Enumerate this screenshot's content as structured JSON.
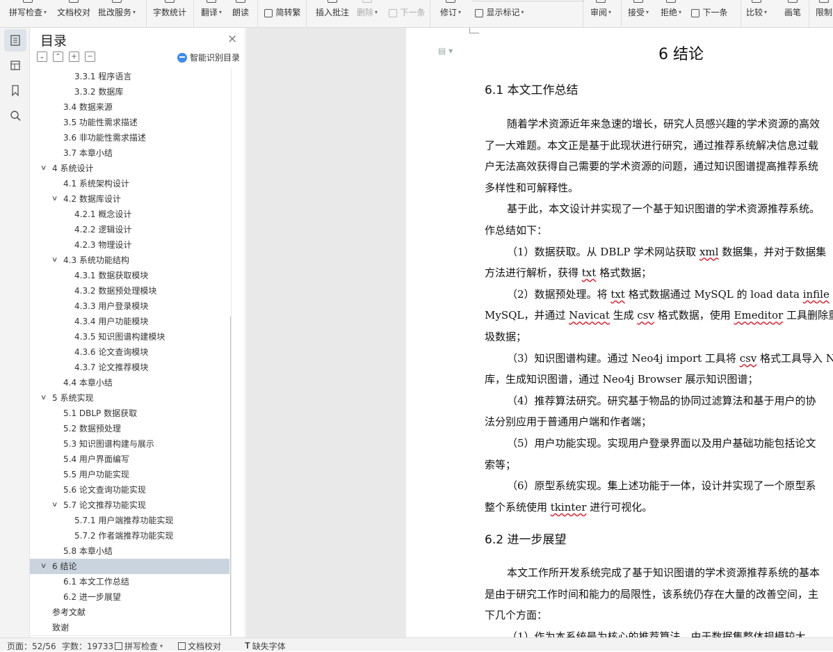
{
  "ribbon": {
    "items": [
      {
        "label": "拼写检查",
        "caret": true
      },
      {
        "label": "文档校对",
        "caret": false
      },
      {
        "label": "批改服务",
        "caret": true
      },
      {
        "label": "字数统计",
        "caret": false
      },
      {
        "label": "翻译",
        "caret": true
      },
      {
        "label": "朗读",
        "caret": false
      },
      {
        "label": "简转繁",
        "caret": false
      },
      {
        "label": "插入批注",
        "caret": false
      },
      {
        "label": "删除",
        "caret": true
      },
      {
        "label": "下一条",
        "caret": false
      },
      {
        "label": "修订",
        "caret": true
      },
      {
        "label": "显示标记",
        "caret": true
      },
      {
        "label": "审阅",
        "caret": true
      },
      {
        "label": "接受",
        "caret": true
      },
      {
        "label": "拒绝",
        "caret": true
      },
      {
        "label": "下一条",
        "caret": false
      },
      {
        "label": "比较",
        "caret": true
      },
      {
        "label": "画笔",
        "caret": false
      },
      {
        "label": "限制",
        "caret": false
      }
    ]
  },
  "toc": {
    "title": "目录",
    "close": "×",
    "tool_icons": [
      "⌄",
      "⌃",
      "+",
      "−"
    ],
    "smart_label": "智能识别目录",
    "items": [
      {
        "text": "3.3.1  程序语言",
        "level": 3
      },
      {
        "text": "3.3.2  数据库",
        "level": 3
      },
      {
        "text": "3.4  数据来源",
        "level": 2
      },
      {
        "text": "3.5  功能性需求描述",
        "level": 2
      },
      {
        "text": "3.6  非功能性需求描述",
        "level": 2
      },
      {
        "text": "3.7  本章小结",
        "level": 2
      },
      {
        "text": "4  系统设计",
        "level": 1,
        "expanded": true
      },
      {
        "text": "4.1  系统架构设计",
        "level": 2
      },
      {
        "text": "4.2  数据库设计",
        "level": 2,
        "expanded": true
      },
      {
        "text": "4.2.1  概念设计",
        "level": 3
      },
      {
        "text": "4.2.2  逻辑设计",
        "level": 3
      },
      {
        "text": "4.2.3  物理设计",
        "level": 3
      },
      {
        "text": "4.3  系统功能结构",
        "level": 2,
        "expanded": true
      },
      {
        "text": "4.3.1  数据获取模块",
        "level": 3
      },
      {
        "text": "4.3.2  数据预处理模块",
        "level": 3
      },
      {
        "text": "4.3.3  用户登录模块",
        "level": 3
      },
      {
        "text": "4.3.4  用户功能模块",
        "level": 3
      },
      {
        "text": "4.3.5  知识图谱构建模块",
        "level": 3
      },
      {
        "text": "4.3.6  论文查询模块",
        "level": 3
      },
      {
        "text": "4.3.7  论文推荐模块",
        "level": 3
      },
      {
        "text": "4.4  本章小结",
        "level": 2
      },
      {
        "text": "5  系统实现",
        "level": 1,
        "expanded": true
      },
      {
        "text": "5.1 DBLP 数据获取",
        "level": 2
      },
      {
        "text": "5.2  数据预处理",
        "level": 2
      },
      {
        "text": "5.3  知识图谱构建与展示",
        "level": 2
      },
      {
        "text": "5.4  用户界面编写",
        "level": 2
      },
      {
        "text": "5.5  用户功能实现",
        "level": 2
      },
      {
        "text": "5.6  论文查询功能实现",
        "level": 2
      },
      {
        "text": "5.7  论文推荐功能实现",
        "level": 2,
        "expanded": true
      },
      {
        "text": "5.7.1  用户端推荐功能实现",
        "level": 3
      },
      {
        "text": "5.7.2  作者端推荐功能实现",
        "level": 3
      },
      {
        "text": "5.8  本章小结",
        "level": 2
      },
      {
        "text": "6  结论",
        "level": 1,
        "expanded": true,
        "selected": true
      },
      {
        "text": "6.1  本文工作总结",
        "level": 2
      },
      {
        "text": "6.2  进一步展望",
        "level": 2
      },
      {
        "text": "参考文献",
        "level": 1
      },
      {
        "text": "致谢",
        "level": 1
      }
    ]
  },
  "document": {
    "chapter_title": "6  结论",
    "section1_title": "6.1  本文工作总结",
    "section2_title": "6.2  进一步展望",
    "lines": [
      {
        "t": 0,
        "indent": true,
        "segs": [
          {
            "s": "随着学术资源近年来急速的增长，研究人员感兴趣的学术资源的高效"
          }
        ]
      },
      {
        "t": 0,
        "indent": false,
        "segs": [
          {
            "s": "了一大难题。本文正是基于此现状进行研究，通过推荐系统解决信息过载"
          }
        ]
      },
      {
        "t": 0,
        "indent": false,
        "segs": [
          {
            "s": "户无法高效获得自己需要的学术资源的问题，通过知识图谱提高推荐系统"
          }
        ]
      },
      {
        "t": 0,
        "indent": false,
        "segs": [
          {
            "s": "多样性和可解释性。"
          }
        ]
      },
      {
        "t": 0,
        "indent": true,
        "segs": [
          {
            "s": "基于此，本文设计并实现了一个基于知识图谱的学术资源推荐系统。"
          }
        ]
      },
      {
        "t": 0,
        "indent": false,
        "segs": [
          {
            "s": "作总结如下："
          }
        ]
      },
      {
        "t": 0,
        "indent": true,
        "segs": [
          {
            "s": "（1）数据获取。从 DBLP 学术网站获取 "
          },
          {
            "s": "xml",
            "sq": true
          },
          {
            "s": " 数据集，并对于数据集"
          }
        ]
      },
      {
        "t": 0,
        "indent": false,
        "segs": [
          {
            "s": "方法进行解析，获得 "
          },
          {
            "s": "txt",
            "sq": true
          },
          {
            "s": " 格式数据；"
          }
        ]
      },
      {
        "t": 0,
        "indent": true,
        "segs": [
          {
            "s": "（2）数据预处理。将 "
          },
          {
            "s": "txt",
            "sq": true
          },
          {
            "s": " 格式数据通过 MySQL 的 load data "
          },
          {
            "s": "infile",
            "sq": true
          }
        ]
      },
      {
        "t": 0,
        "indent": false,
        "segs": [
          {
            "s": "MySQL，并通过 "
          },
          {
            "s": "Navicat",
            "sq": true
          },
          {
            "s": " 生成 "
          },
          {
            "s": "csv",
            "sq": true
          },
          {
            "s": " 格式数据，使用 "
          },
          {
            "s": "Emeditor",
            "sq": true
          },
          {
            "s": " 工具删除重复"
          }
        ]
      },
      {
        "t": 0,
        "indent": false,
        "segs": [
          {
            "s": "圾数据；"
          }
        ]
      },
      {
        "t": 0,
        "indent": true,
        "segs": [
          {
            "s": "（3）知识图谱构建。通过 Neo4j import 工具将 "
          },
          {
            "s": "csv",
            "sq": true
          },
          {
            "s": " 格式工具导入 Ne"
          }
        ]
      },
      {
        "t": 0,
        "indent": false,
        "segs": [
          {
            "s": "库，生成知识图谱，通过 Neo4j Browser 展示知识图谱；"
          }
        ]
      },
      {
        "t": 0,
        "indent": true,
        "segs": [
          {
            "s": "（4）推荐算法研究。研究基于物品的协同过滤算法和基于用户的协"
          }
        ]
      },
      {
        "t": 0,
        "indent": false,
        "segs": [
          {
            "s": "法分别应用于普通用户端和作者端；"
          }
        ]
      },
      {
        "t": 0,
        "indent": true,
        "segs": [
          {
            "s": "（5）用户功能实现。实现用户登录界面以及用户基础功能包括论文"
          }
        ]
      },
      {
        "t": 0,
        "indent": false,
        "segs": [
          {
            "s": "索等；"
          }
        ]
      },
      {
        "t": 0,
        "indent": true,
        "segs": [
          {
            "s": "（6）原型系统实现。集上述功能于一体，设计并实现了一个原型系"
          }
        ]
      },
      {
        "t": 0,
        "indent": false,
        "segs": [
          {
            "s": "整个系统使用 "
          },
          {
            "s": "tkinter",
            "sq": true
          },
          {
            "s": " 进行可视化。"
          }
        ]
      },
      {
        "t": 1,
        "indent": true,
        "segs": [
          {
            "s": "本文工作所开发系统完成了基于知识图谱的学术资源推荐系统的基本"
          }
        ]
      },
      {
        "t": 1,
        "indent": false,
        "segs": [
          {
            "s": "是由于研究工作时间和能力的局限性，该系统仍存在大量的改善空间，主"
          }
        ]
      },
      {
        "t": 1,
        "indent": false,
        "segs": [
          {
            "s": "下几个方面："
          }
        ]
      },
      {
        "t": 1,
        "indent": true,
        "segs": [
          {
            "s": "（1）作为本系统最为核心的推荐算法，由于数据集整体规模较大，"
          }
        ]
      }
    ]
  },
  "status": {
    "page": "页面：52/56",
    "words": "字数：19733",
    "spell": "拼写检查",
    "proof": "文档校对",
    "font": "缺失字体"
  }
}
